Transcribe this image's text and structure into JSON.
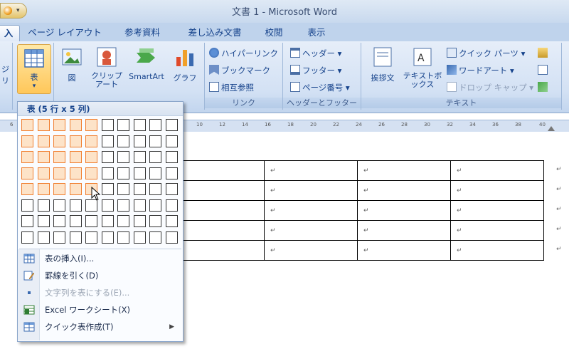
{
  "window": {
    "title": "文書 1 - Microsoft Word"
  },
  "tabs": [
    {
      "label": "入",
      "active": true
    },
    {
      "label": "ページ レイアウト",
      "active": false
    },
    {
      "label": "参考資料",
      "active": false
    },
    {
      "label": "差し込み文書",
      "active": false
    },
    {
      "label": "校閲",
      "active": false
    },
    {
      "label": "表示",
      "active": false
    }
  ],
  "ribbon": {
    "left_fragment": "ジ\nリ",
    "table_btn": {
      "label": "表",
      "arrow": "▾"
    },
    "illustrations": {
      "picture": "図",
      "clipart": "クリップアート",
      "smartart": "SmartArt",
      "chart": "グラフ"
    },
    "links": {
      "hyperlink": "ハイパーリンク",
      "bookmark": "ブックマーク",
      "crossref": "相互参照",
      "group_label": "リンク"
    },
    "header_footer": {
      "header": "ヘッダー",
      "footer": "フッター",
      "page_number": "ページ番号",
      "group_label": "ヘッダーとフッター"
    },
    "text": {
      "greeting": "挨拶文",
      "textbox": "テキストボックス",
      "quickparts": "クイック パーツ",
      "wordart": "ワードアート",
      "dropcap": "ドロップ キャップ",
      "group_label": "テキスト"
    }
  },
  "ruler": {
    "numbers": [
      "6",
      "10",
      "12",
      "14",
      "16",
      "18",
      "20",
      "22",
      "24",
      "26",
      "28",
      "30",
      "32",
      "34",
      "36",
      "38",
      "40"
    ]
  },
  "table_dropdown": {
    "header": "表 (5 行 x 5 列)",
    "grid_cols": 10,
    "grid_rows": 8,
    "selected_cols": 5,
    "selected_rows": 5,
    "items": [
      {
        "label": "表の挿入(I)...",
        "disabled": false,
        "submenu": false
      },
      {
        "label": "罫線を引く(D)",
        "disabled": false,
        "submenu": false
      },
      {
        "label": "文字列を表にする(E)...",
        "disabled": true,
        "submenu": false
      },
      {
        "label": "Excel ワークシート(X)",
        "disabled": false,
        "submenu": false
      },
      {
        "label": "クイック表作成(T)",
        "disabled": false,
        "submenu": true
      }
    ]
  },
  "document": {
    "cell_mark": "↵",
    "rows": 5,
    "cols": 4
  },
  "colors": {
    "ribbon_bg": "#d3e1f4",
    "selected_cell": "#f07e2e",
    "accent": "#15428b"
  }
}
